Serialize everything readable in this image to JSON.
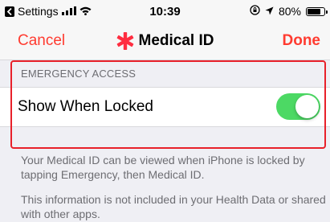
{
  "status_bar": {
    "back_app": "Settings",
    "time": "10:39",
    "battery": "80%",
    "battery_level": 0.8
  },
  "nav": {
    "cancel_label": "Cancel",
    "title": "Medical ID",
    "done_label": "Done"
  },
  "emergency": {
    "section_header": "EMERGENCY ACCESS",
    "row_label": "Show When Locked",
    "toggle_on": true
  },
  "footer": {
    "paragraph_1": "Your Medical ID can be viewed when iPhone is locked by tapping Emergency, then Medical ID.",
    "paragraph_2": "This information is not included in your Health Data or shared with other apps."
  },
  "colors": {
    "accent": "#ff3b30",
    "toggle_on": "#4cd964",
    "highlight": "#e8202a"
  },
  "icons": {
    "back_app": "back-arrow-icon",
    "signal": "cellular-signal-icon",
    "wifi": "wifi-icon",
    "orientation_lock": "orientation-lock-icon",
    "location": "location-arrow-icon",
    "battery": "battery-icon",
    "medical": "medical-star-icon"
  }
}
